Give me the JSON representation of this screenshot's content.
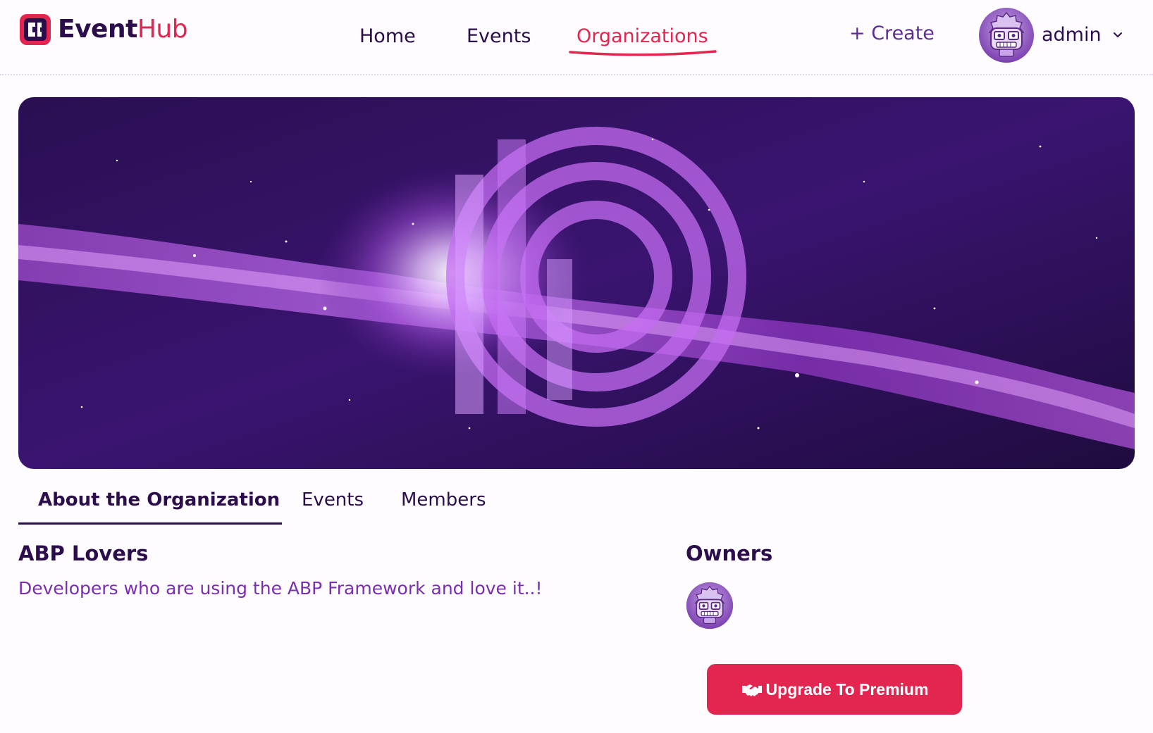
{
  "header": {
    "logo_text_event": "Event",
    "logo_text_hub": "Hub",
    "nav": [
      {
        "label": "Home",
        "active": false
      },
      {
        "label": "Events",
        "active": false
      },
      {
        "label": "Organizations",
        "active": true
      }
    ],
    "create_label": "+ Create",
    "user_name": "admin",
    "avatar_icon": "robot-avatar-icon",
    "chevron_icon": "chevron-down-icon"
  },
  "banner": {
    "description": "abp-logo-galaxy-banner"
  },
  "tabs": [
    {
      "label": "About the Organization",
      "active": true
    },
    {
      "label": "Events",
      "active": false
    },
    {
      "label": "Members",
      "active": false
    }
  ],
  "organization": {
    "name": "ABP Lovers",
    "description": "Developers who are using the ABP Framework and love it..!"
  },
  "owners": {
    "title": "Owners"
  },
  "upgrade_button": {
    "label": "Upgrade To Premium",
    "icon": "handshake-icon"
  },
  "colors": {
    "brand_red": "#e2264f",
    "primary_dark": "#2a0d4a",
    "accent_purple": "#7a2eb0"
  }
}
